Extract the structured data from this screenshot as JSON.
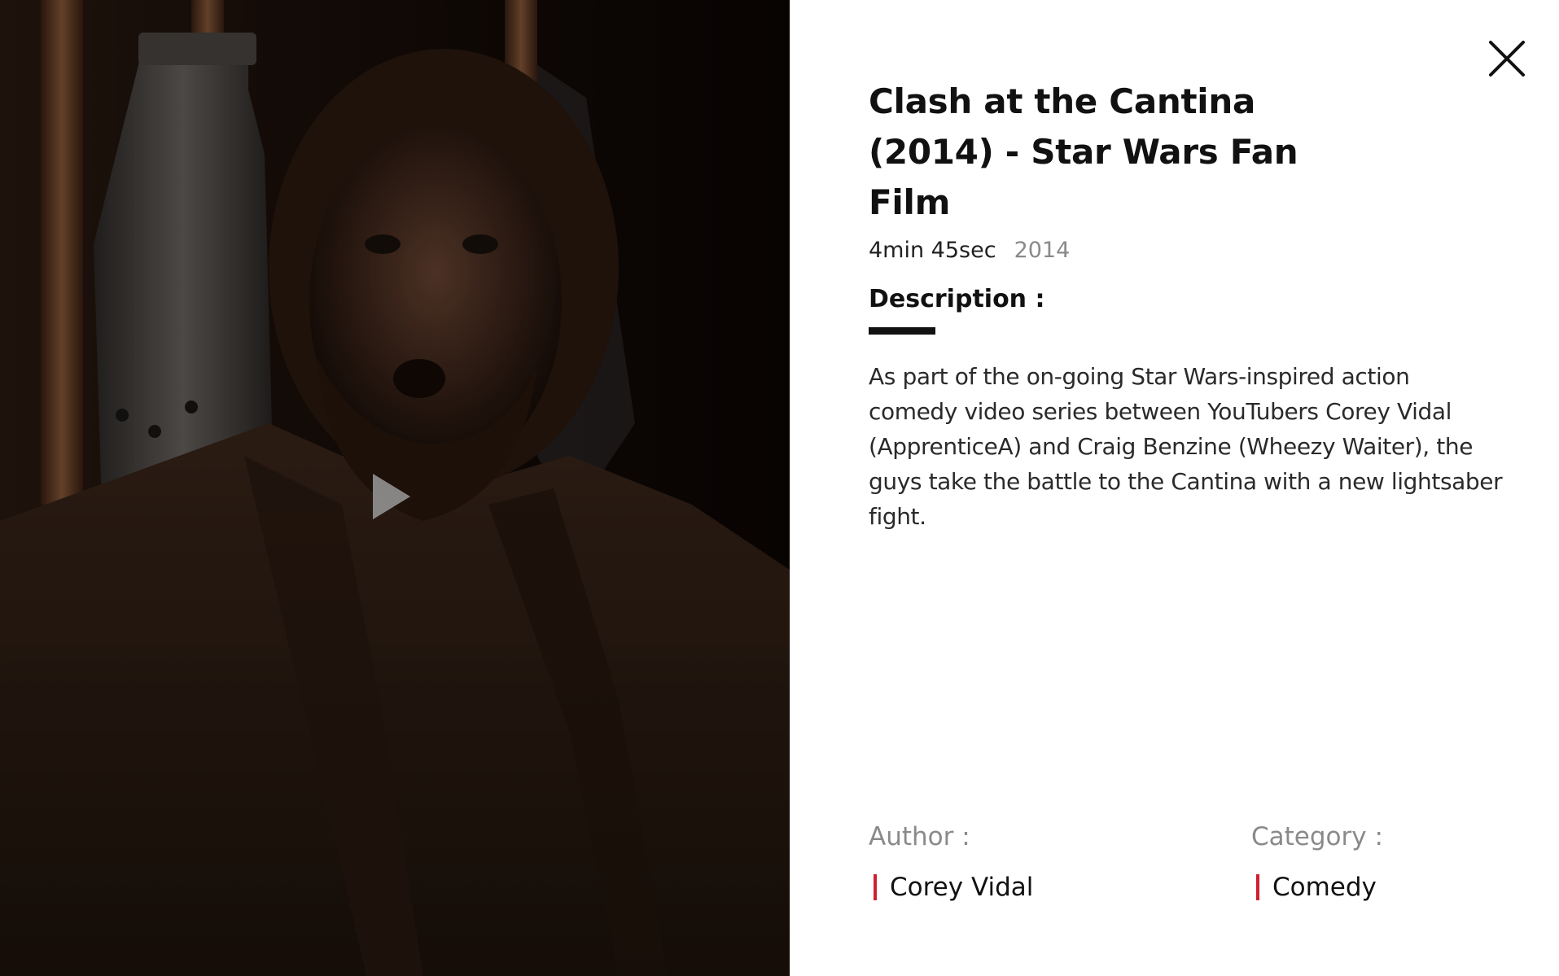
{
  "video": {
    "play_icon": "play-icon"
  },
  "info": {
    "close_icon": "close-icon",
    "title": "Clash at the Cantina (2014) - Star Wars Fan Film",
    "duration": "4min 45sec",
    "year": "2014",
    "description_heading": "Description :",
    "description": "As part of the on-going Star Wars-inspired action comedy video series between YouTubers Corey Vidal (ApprenticeA) and Craig Benzine (Wheezy Waiter), the guys take the battle to the Cantina with a new lightsaber fight.",
    "author_label": "Author :",
    "author_value": "Corey Vidal",
    "category_label": "Category :",
    "category_value": "Comedy"
  },
  "colors": {
    "accent": "#d0202e",
    "text": "#111111",
    "muted": "#8a8a8a",
    "video_bg": "#120a06"
  }
}
